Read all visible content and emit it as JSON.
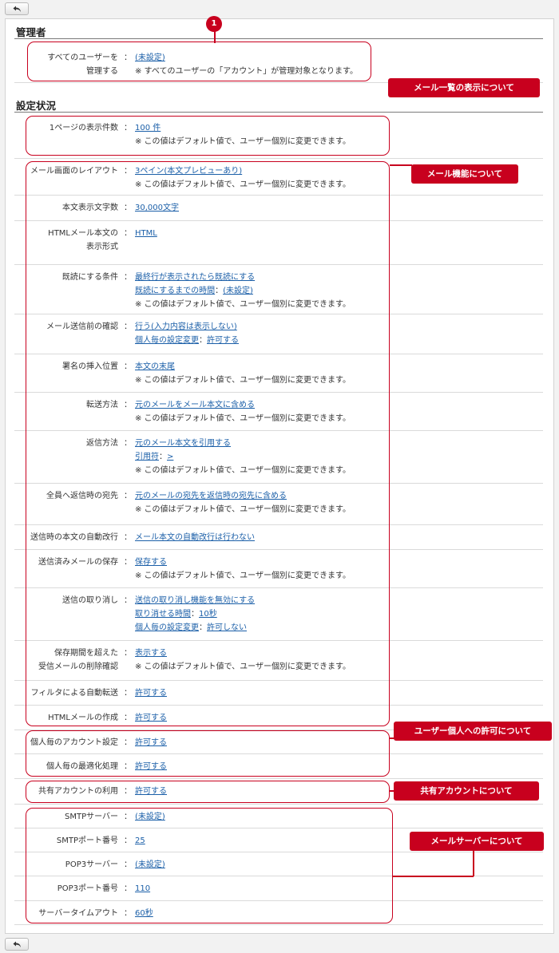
{
  "nav": {
    "back_icon": "back-arrow-icon"
  },
  "badge_number": "1",
  "sections": {
    "admin_title": "管理者",
    "settings_title": "設定状況"
  },
  "admin_row": {
    "label_line1": "すべてのユーザーを",
    "label_line2": "管理する",
    "value": "(未設定)",
    "note": "※ すべてのユーザーの「アカウント」が管理対象となります。"
  },
  "default_note": "※ この値はデフォルト値で、ユーザー個別に変更できます。",
  "rows": [
    {
      "label": "1ページの表示件数",
      "link": "100 件"
    },
    {
      "label": "メール画面のレイアウト",
      "link": "3ペイン(本文プレビューあり)"
    },
    {
      "label": "本文表示文字数",
      "link": "30,000文字"
    },
    {
      "label1": "HTMLメール本文の",
      "label2": "表示形式",
      "link": "HTML"
    },
    {
      "label": "既読にする条件",
      "link": "最終行が表示されたら既読にする",
      "sub_link": "既読にするまでの時間",
      "sub_sep": "：",
      "sub_value": "(未設定)"
    },
    {
      "label": "メール送信前の確認",
      "link": "行う(入力内容は表示しない)",
      "sub_link": "個人毎の設定変更",
      "sub_sep": "：",
      "sub_value": "許可する"
    },
    {
      "label": "署名の挿入位置",
      "link": "本文の末尾"
    },
    {
      "label": "転送方法",
      "link": "元のメールをメール本文に含める"
    },
    {
      "label": "返信方法",
      "link": "元のメール本文を引用する",
      "sub_link": "引用符",
      "sub_sep": "：",
      "sub_value": ">"
    },
    {
      "label": "全員へ返信時の宛先",
      "link": "元のメールの宛先を返信時の宛先に含める"
    },
    {
      "label": "送信時の本文の自動改行",
      "link": "メール本文の自動改行は行わない"
    },
    {
      "label": "送信済みメールの保存",
      "link": "保存する"
    },
    {
      "label": "送信の取り消し",
      "link": "送信の取り消し機能を無効にする",
      "sub_link": "取り消せる時間",
      "sub_sep": "：",
      "sub_value": "10秒",
      "sub2_link": "個人毎の設定変更",
      "sub2_value": "許可しない"
    },
    {
      "label1": "保存期間を超えた",
      "label2": "受信メールの削除確認",
      "link": "表示する"
    },
    {
      "label": "フィルタによる自動転送",
      "link": "許可する"
    },
    {
      "label": "HTMLメールの作成",
      "link": "許可する"
    },
    {
      "label": "個人毎のアカウント設定",
      "link": "許可する"
    },
    {
      "label": "個人毎の最適化処理",
      "link": "許可する"
    },
    {
      "label": "共有アカウントの利用",
      "link": "許可する"
    },
    {
      "label": "SMTPサーバー",
      "link": "(未設定)"
    },
    {
      "label": "SMTPポート番号",
      "link": "25"
    },
    {
      "label": "POP3サーバー",
      "link": "(未設定)"
    },
    {
      "label": "POP3ポート番号",
      "link": "110"
    },
    {
      "label": "サーバータイムアウト",
      "link": "60秒"
    }
  ],
  "colon": "：",
  "callouts": {
    "list_display": "メール一覧の表示について",
    "mail_function": "メール機能について",
    "user_permission": "ユーザー個人への許可について",
    "shared_account": "共有アカウントについて",
    "mail_server": "メールサーバーについて"
  },
  "colors": {
    "accent": "#c8001e",
    "link": "#1b5fa8"
  }
}
